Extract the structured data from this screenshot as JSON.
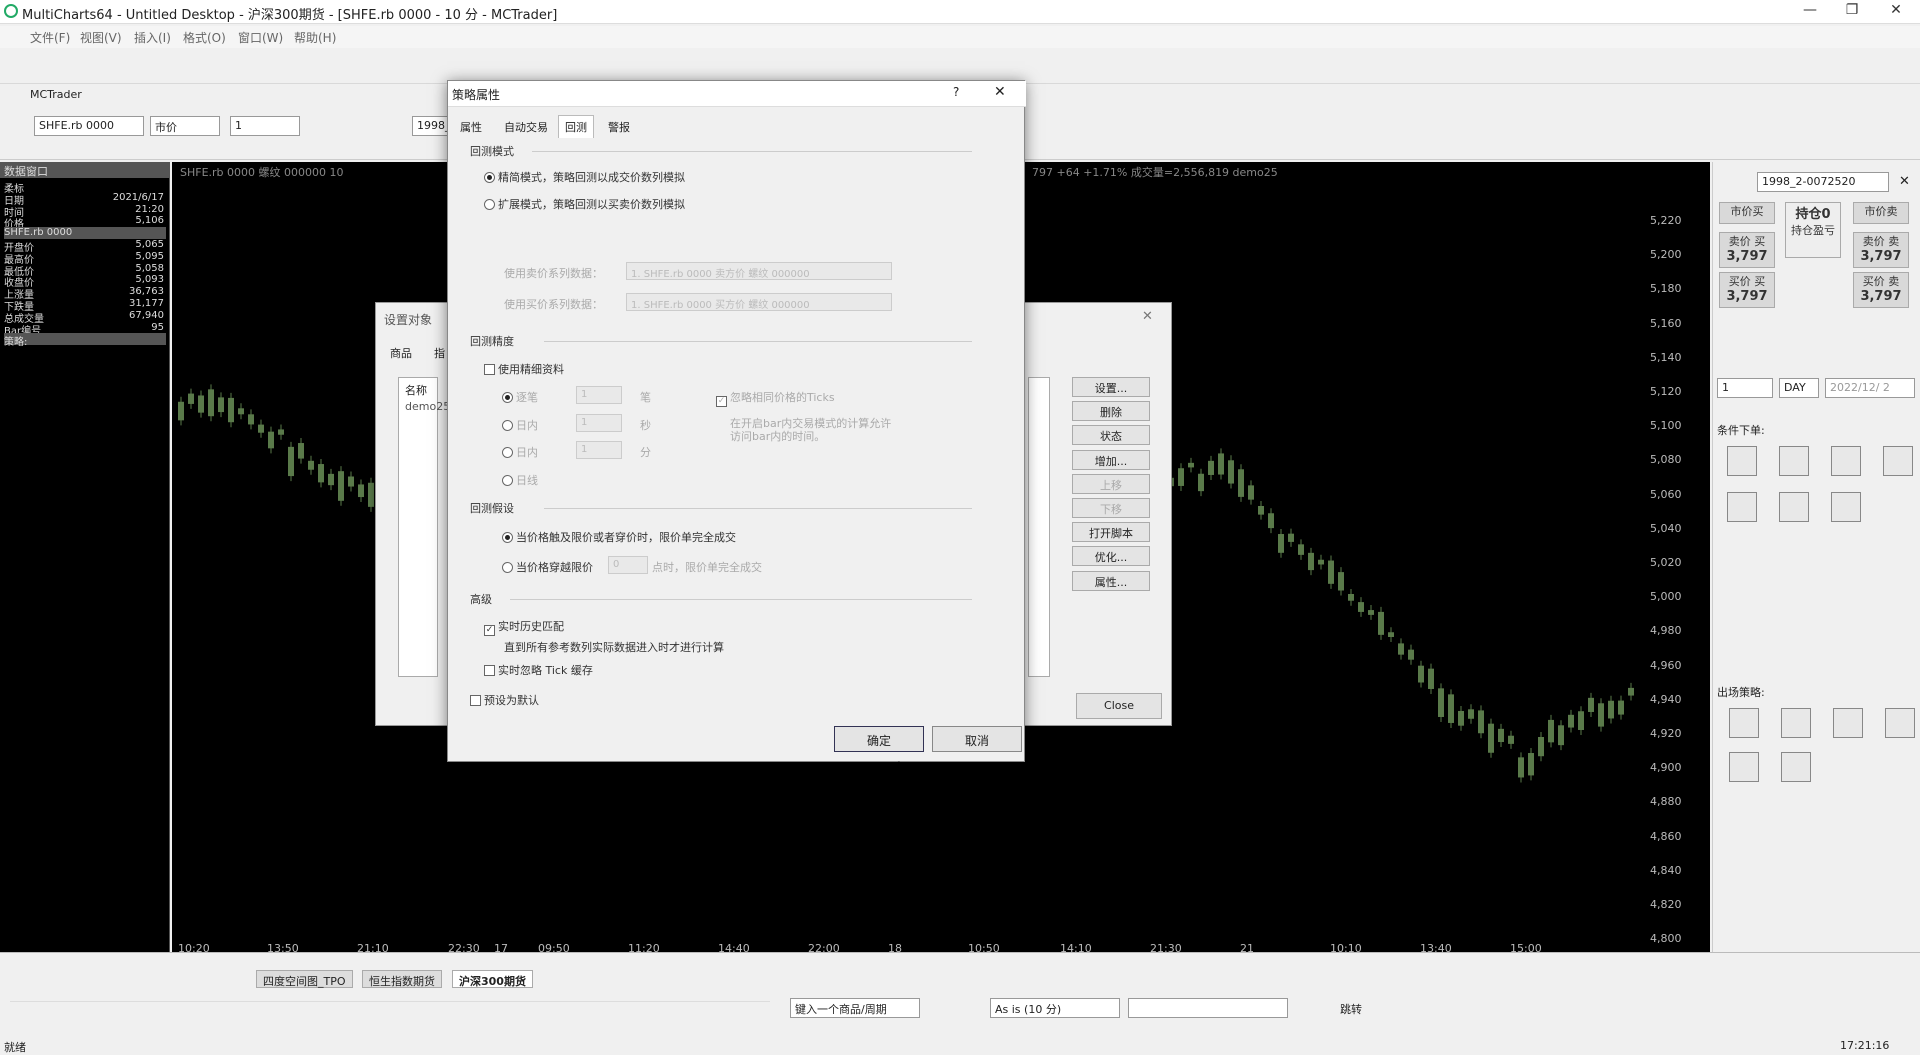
{
  "window": {
    "title": "MultiCharts64 - Untitled Desktop - 沪深300期货 - [SHFE.rb 0000 - 10 分 - MCTrader]"
  },
  "menu": [
    "文件(F)",
    "视图(V)",
    "插入(I)",
    "格式(O)",
    "窗口(W)",
    "帮助(H)"
  ],
  "chart_window": {
    "tab": "MCTrader",
    "symbol": "SHFE.rb 0000",
    "order_type": "市价",
    "qty": "1",
    "account": "1998_"
  },
  "data_window": {
    "title": "数据窗口",
    "rows": [
      {
        "k": "柔标",
        "v": ""
      },
      {
        "k": "日期",
        "v": "2021/6/17"
      },
      {
        "k": "时间",
        "v": "21:20"
      },
      {
        "k": "价格",
        "v": "5,106"
      },
      {
        "k": "SHFE.rb 0000",
        "v": ""
      },
      {
        "k": "开盘价",
        "v": "5,065"
      },
      {
        "k": "最高价",
        "v": "5,095"
      },
      {
        "k": "最低价",
        "v": "5,058"
      },
      {
        "k": "收盘价",
        "v": "5,093"
      },
      {
        "k": "上涨量",
        "v": "36,763"
      },
      {
        "k": "下跌量",
        "v": "31,177"
      },
      {
        "k": "总成交量",
        "v": "67,940"
      },
      {
        "k": "Bar编号",
        "v": "95"
      },
      {
        "k": "策略:",
        "v": ""
      }
    ]
  },
  "chart": {
    "info": "SHFE.rb 0000  螺纹 000000  10",
    "info_right": "797  +64  +1.71%  成交量=2,556,819  demo25",
    "price_labels": [
      "5,220",
      "5,200",
      "5,180",
      "5,160",
      "5,140",
      "5,120",
      "5,100",
      "5,080",
      "5,060",
      "5,040",
      "5,020",
      "5,000",
      "4,980",
      "4,960",
      "4,940",
      "4,920",
      "4,900",
      "4,880",
      "4,860",
      "4,840",
      "4,820",
      "4,800"
    ],
    "time_labels": [
      "10:20",
      "13:50",
      "21:10",
      "22:30",
      "17",
      "09:50",
      "11:20",
      "14:40",
      "22:00",
      "18",
      "10:50",
      "14:10",
      "21:30",
      "21",
      "10:10",
      "13:40",
      "15:00"
    ]
  },
  "right_panel": {
    "account": "1998_2-0072520",
    "btn_market_buy": "市价买",
    "btn_position": "持仓0",
    "btn_pnl": "持仓盈亏",
    "btn_market_sell": "市价卖",
    "sell_label": "卖价 买",
    "sell_price": "3,797",
    "sell_label2": "卖价 卖",
    "sell_price2": "3,797",
    "buy_label": "买价 买",
    "buy_price": "3,797",
    "buy_label2": "买价 卖",
    "buy_price2": "3,797",
    "qty": "1",
    "tif": "DAY",
    "date": "2022/12/ 2",
    "cond_title": "条件下单:",
    "exit_title": "出场策略:"
  },
  "setup_dialog": {
    "title": "设置对象",
    "tab1": "商品",
    "tab2": "指",
    "col_name": "名称",
    "item": "demo25",
    "buttons": [
      "设置...",
      "删除",
      "状态",
      "增加...",
      "上移",
      "下移",
      "打开脚本",
      "优化...",
      "属性..."
    ],
    "close": "Close"
  },
  "strategy_dialog": {
    "title": "策略属性",
    "help": "?",
    "close": "✕",
    "tabs": [
      "属性",
      "自动交易",
      "回测",
      "警报"
    ],
    "sec_mode": "回测模式",
    "mode1": "精简模式，策略回测以成交价数列模拟",
    "mode2": "扩展模式，策略回测以买卖价数列模拟",
    "ask_label": "使用卖价系列数据：",
    "ask_value": "1. SHFE.rb 0000 卖方价 螺纹 000000",
    "bid_label": "使用买价系列数据：",
    "bid_value": "1. SHFE.rb 0000 买方价 螺纹 000000",
    "sec_precision": "回测精度",
    "use_precise": "使用精细资料",
    "p1": "逐笔",
    "p1u": "笔",
    "p2": "日内",
    "p2u": "秒",
    "p3": "日内",
    "p3u": "分",
    "p4": "日线",
    "pval": "1",
    "ignore_ticks": "忽略相同价格的Ticks",
    "intrabar_note": "在开启bar内交易模式的计算允许访问bar内的时间。",
    "sec_assume": "回测假设",
    "assume1": "当价格触及限价或者穿价时，限价单完全成交",
    "assume2": "当价格穿越限价",
    "assume2_val": "0",
    "assume2_tail": "点时，限价单完全成交",
    "sec_adv": "高级",
    "rt_match": "实时历史匹配",
    "rt_note": "直到所有参考数列实际数据进入时才进行计算",
    "ignore_tick_cache": "实时忽略 Tick 缓存",
    "set_default": "预设为默认",
    "ok": "确定",
    "cancel": "取消"
  },
  "bottom": {
    "tabs": [
      "四度空间图_TPO",
      "恒生指数期货",
      "沪深300期货"
    ],
    "symbol_input": "键入一个商品/周期",
    "as_is": "As is (10 分)",
    "jump": "跳转",
    "status": "就绪",
    "clock": "17:21:16"
  }
}
